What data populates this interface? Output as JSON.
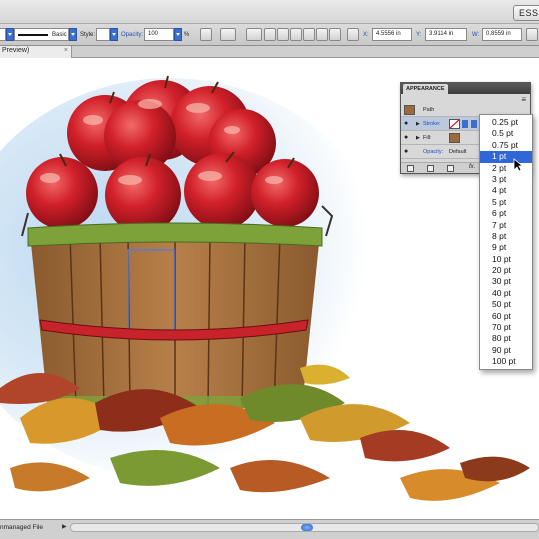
{
  "workspace": {
    "label": "ESS"
  },
  "control_bar": {
    "brush_label": "Basic",
    "style_label": "Style:",
    "opacity_label": "Opacity:",
    "opacity_value": "100",
    "percent_sign": "%",
    "x_label": "X:",
    "x_value": "4.5556 in",
    "y_label": "Y:",
    "y_value": "3.9114 in",
    "w_label": "W:",
    "w_value": "0.8559 in"
  },
  "document_tab": {
    "title": "Preview)",
    "close": "×"
  },
  "appearance_panel": {
    "title": "APPEARANCE",
    "path_label": "Path",
    "stroke_label": "Stroke:",
    "fill_label": "Fill:",
    "opacity_label": "Opacity:",
    "opacity_value": "Default",
    "fx_label": "fx.",
    "menu_icon": "≡"
  },
  "stroke_weight_options": [
    "0.25 pt",
    "0.5 pt",
    "0.75 pt",
    "1 pt",
    "2 pt",
    "3 pt",
    "4 pt",
    "5 pt",
    "6 pt",
    "7 pt",
    "8 pt",
    "9 pt",
    "10 pt",
    "20 pt",
    "30 pt",
    "40 pt",
    "50 pt",
    "60 pt",
    "70 pt",
    "80 pt",
    "90 pt",
    "100 pt"
  ],
  "stroke_weight_selected": "1 pt",
  "status_bar": {
    "text": "nmanaged File",
    "arrow": "▶"
  },
  "icons": {
    "eye": "eye-icon",
    "no_stroke": "no-stroke-icon",
    "fill_swatch": "fill-swatch-icon",
    "disclosure": "disclosure-triangle-icon",
    "panel_menu": "panel-menu-icon",
    "cursor": "arrow-pointer-icon"
  },
  "colors": {
    "selection_blue": "#2f67d6",
    "accent_blue": "#3a6fd1",
    "fill_swatch": "#9a6a3a"
  }
}
